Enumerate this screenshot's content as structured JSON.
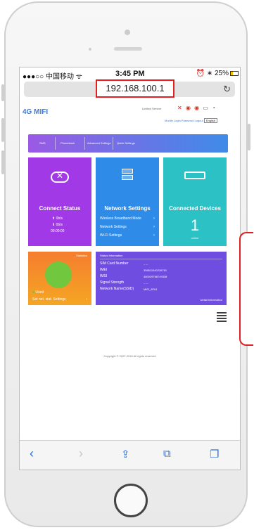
{
  "status_bar": {
    "carrier": "●●●○○ 中国移动 ᯤ",
    "time": "3:45 PM",
    "battery_text": "⏰ ∗ 25%"
  },
  "browser": {
    "url": "192.168.100.1",
    "reload_icon": "reload-icon"
  },
  "header": {
    "logo": "4G MIFI",
    "limited_service": "Limited Service",
    "links": [
      "Modify Login Password",
      "Logout"
    ],
    "language": "English"
  },
  "menu": {
    "items": [
      "SMS",
      "Phonebook",
      "Advanced Settings",
      "Quick Settings"
    ]
  },
  "connect_status": {
    "title": "Connect Status",
    "up": "0b/s",
    "down": "0b/s",
    "duration": "00:00:00"
  },
  "network_settings": {
    "title": "Network Settings",
    "items": [
      "Wireless Broadband Mode",
      "Network Settings",
      "Wi-Fi Settings"
    ]
  },
  "connected_devices": {
    "title": "Connected Devices",
    "count": "1",
    "label": "online"
  },
  "statistics": {
    "title": "Statistics",
    "legend": "Used",
    "settings_link": "Set net. stat. Settings"
  },
  "status_information": {
    "title": "Status Information",
    "rows": [
      {
        "label": "SIM Card Number",
        "value": "-- --"
      },
      {
        "label": "IMEI",
        "value": "358511040226781"
      },
      {
        "label": "IMSI",
        "value": "460029768749338"
      },
      {
        "label": "Signal Strength",
        "value": "-- --"
      },
      {
        "label": "Network Name(SSID)",
        "value": "MIFI_5FA1"
      }
    ],
    "detail_link": "Detail Information"
  },
  "footer": {
    "copyright": "Copyright © 2007-2016 All rights reserved"
  },
  "colors": {
    "accent": "#3d7bd9",
    "highlight": "#e02020"
  }
}
